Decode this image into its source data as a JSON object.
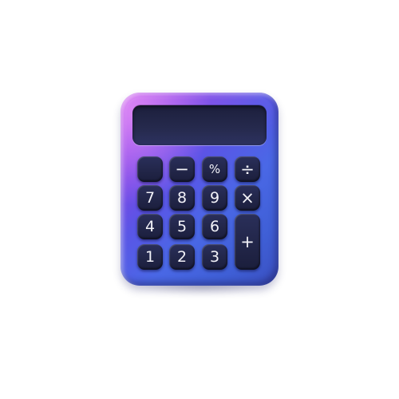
{
  "calculator": {
    "display_value": "",
    "keys_row1": [
      "",
      "−",
      "%",
      "÷"
    ],
    "keys_row2": [
      "7",
      "8",
      "9",
      "×"
    ],
    "keys_row3": [
      "4",
      "5",
      "6"
    ],
    "keys_row4": [
      "1",
      "2",
      "3"
    ],
    "key_plus": "+"
  },
  "colors": {
    "body_gradient": [
      "#b13ae6",
      "#5a55e6",
      "#3a4fbf"
    ],
    "display": "#1f2242",
    "key": "#222649",
    "key_text": "#f2f2f8",
    "background": "#ffffff"
  }
}
